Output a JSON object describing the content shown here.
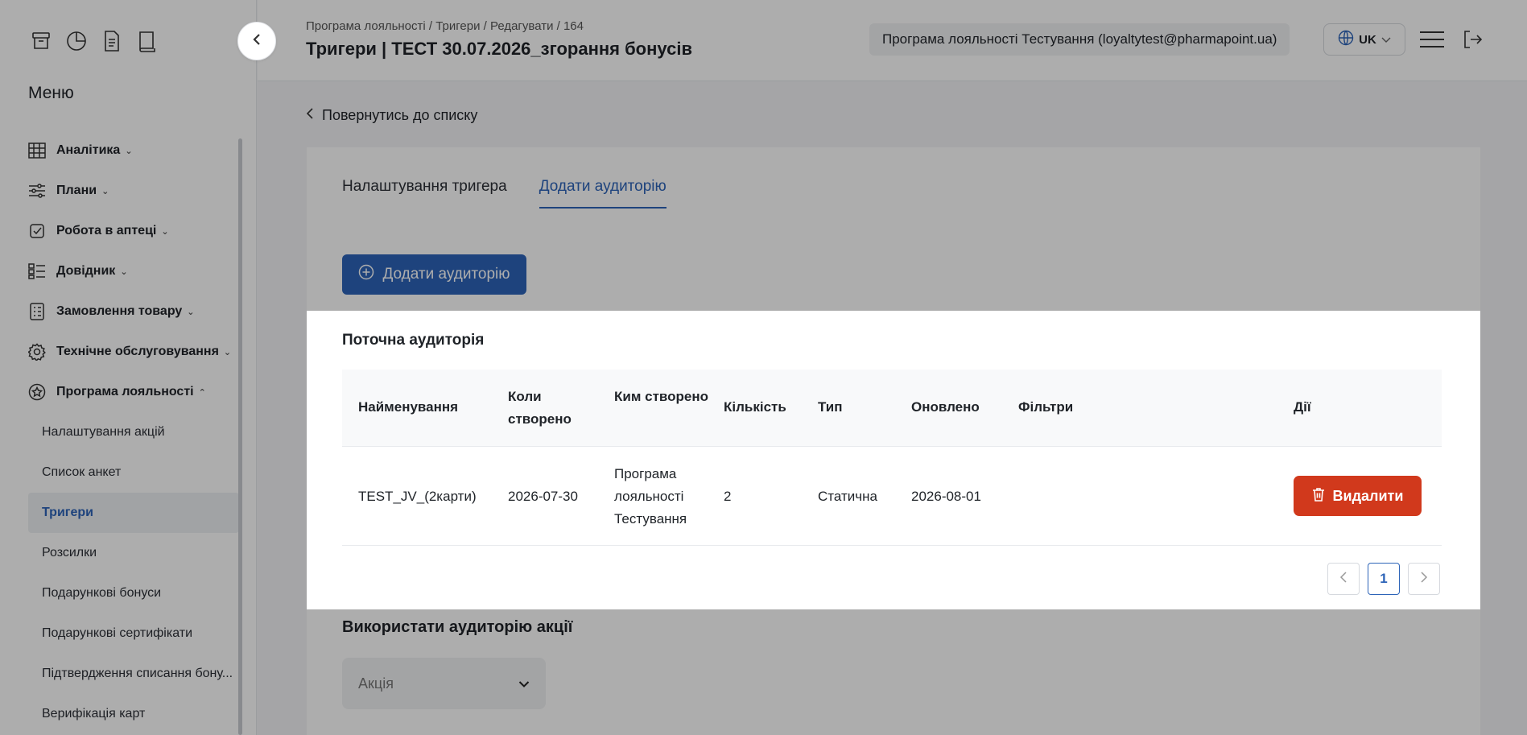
{
  "header": {
    "breadcrumb": "Програма лояльності / Тригери / Редагувати / 164",
    "title": "Тригери | ТЕСТ 30.07.2026_згорання бонусів",
    "account": "Програма лояльності Тестування (loyaltytest@pharmapoint.ua)",
    "language": "UK"
  },
  "sidebar": {
    "menu_title": "Меню",
    "items": [
      {
        "label": "Аналітика",
        "icon": "grid-icon"
      },
      {
        "label": "Плани",
        "icon": "sliders-icon"
      },
      {
        "label": "Робота в аптеці",
        "icon": "checkbox-icon"
      },
      {
        "label": "Довідник",
        "icon": "list-icon"
      },
      {
        "label": "Замовлення товару",
        "icon": "clipboard-icon"
      },
      {
        "label": "Технічне обслуговування",
        "icon": "gear-icon"
      },
      {
        "label": "Програма лояльності",
        "icon": "star-badge-icon"
      }
    ],
    "sub_items": [
      "Налаштування акцій",
      "Список анкет",
      "Тригери",
      "Розсилки",
      "Подарункові бонуси",
      "Подарункові сертифікати",
      "Підтвердження списання бону...",
      "Верифікація карт"
    ]
  },
  "main": {
    "back_label": "Повернутись до списку",
    "tabs": [
      "Налаштування тригера",
      "Додати аудиторію"
    ],
    "add_button": "Додати аудиторію",
    "audience_title": "Поточна аудиторія",
    "columns": [
      "Найменування",
      "Коли створено",
      "Ким створено",
      "Кількість",
      "Тип",
      "Оновлено",
      "Фільтри",
      "Дії"
    ],
    "rows": [
      {
        "name": "TEST_JV_(2карти)",
        "created": "2026-07-30",
        "by": "Програма лояльності Тестування",
        "count": "2",
        "type": "Статична",
        "updated": "2026-08-01",
        "filters": "",
        "action": "Видалити"
      }
    ],
    "page": "1",
    "use_title": "Використати аудиторію акції",
    "select_placeholder": "Акція"
  },
  "colors": {
    "accent": "#2d64b8",
    "danger": "#d1391c"
  }
}
